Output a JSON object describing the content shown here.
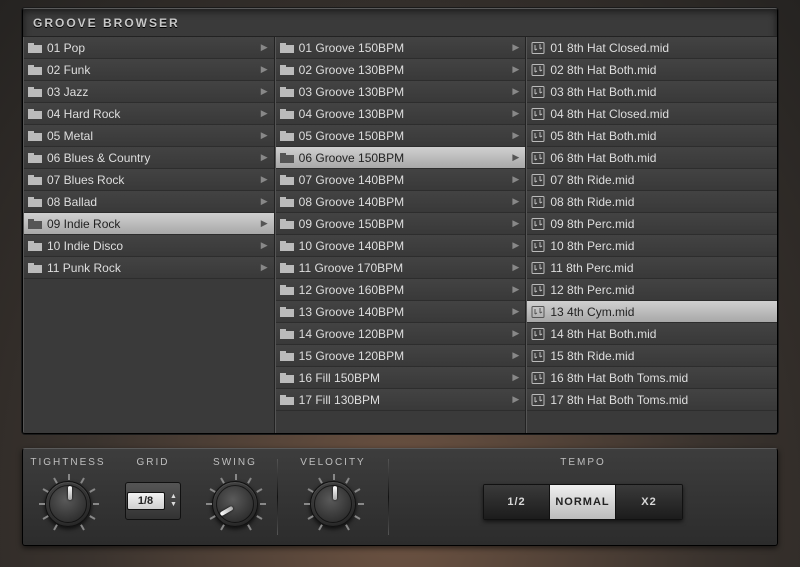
{
  "browser": {
    "title": "GROOVE BROWSER",
    "columns": [
      {
        "type": "folder",
        "selected_index": 8,
        "items": [
          {
            "label": "01 Pop",
            "expandable": true
          },
          {
            "label": "02 Funk",
            "expandable": true
          },
          {
            "label": "03 Jazz",
            "expandable": true
          },
          {
            "label": "04 Hard Rock",
            "expandable": true
          },
          {
            "label": "05 Metal",
            "expandable": true
          },
          {
            "label": "06 Blues & Country",
            "expandable": true
          },
          {
            "label": "07 Blues Rock",
            "expandable": true
          },
          {
            "label": "08 Ballad",
            "expandable": true
          },
          {
            "label": "09 Indie Rock",
            "expandable": true
          },
          {
            "label": "10 Indie Disco",
            "expandable": true
          },
          {
            "label": "11 Punk Rock",
            "expandable": true
          }
        ]
      },
      {
        "type": "folder",
        "selected_index": 5,
        "items": [
          {
            "label": "01 Groove 150BPM",
            "expandable": true
          },
          {
            "label": "02 Groove 130BPM",
            "expandable": true
          },
          {
            "label": "03 Groove 130BPM",
            "expandable": true
          },
          {
            "label": "04 Groove 130BPM",
            "expandable": true
          },
          {
            "label": "05 Groove 150BPM",
            "expandable": true
          },
          {
            "label": "06 Groove 150BPM",
            "expandable": true
          },
          {
            "label": "07 Groove 140BPM",
            "expandable": true
          },
          {
            "label": "08 Groove 140BPM",
            "expandable": true
          },
          {
            "label": "09 Groove 150BPM",
            "expandable": true
          },
          {
            "label": "10 Groove 140BPM",
            "expandable": true
          },
          {
            "label": "11 Groove 170BPM",
            "expandable": true
          },
          {
            "label": "12 Groove 160BPM",
            "expandable": true
          },
          {
            "label": "13 Groove 140BPM",
            "expandable": true
          },
          {
            "label": "14 Groove 120BPM",
            "expandable": true
          },
          {
            "label": "15 Groove 120BPM",
            "expandable": true
          },
          {
            "label": "16 Fill 150BPM",
            "expandable": true
          },
          {
            "label": "17 Fill 130BPM",
            "expandable": true
          }
        ]
      },
      {
        "type": "file",
        "selected_index": 12,
        "items": [
          {
            "label": "01 8th Hat Closed.mid"
          },
          {
            "label": "02 8th Hat Both.mid"
          },
          {
            "label": "03 8th Hat Both.mid"
          },
          {
            "label": "04 8th Hat Closed.mid"
          },
          {
            "label": "05 8th Hat Both.mid"
          },
          {
            "label": "06 8th Hat Both.mid"
          },
          {
            "label": "07 8th Ride.mid"
          },
          {
            "label": "08 8th Ride.mid"
          },
          {
            "label": "09 8th Perc.mid"
          },
          {
            "label": "10 8th Perc.mid"
          },
          {
            "label": "11 8th Perc.mid"
          },
          {
            "label": "12 8th Perc.mid"
          },
          {
            "label": "13 4th Cym.mid"
          },
          {
            "label": "14 8th Hat Both.mid"
          },
          {
            "label": "15 8th Ride.mid"
          },
          {
            "label": "16 8th Hat Both Toms.mid"
          },
          {
            "label": "17 8th Hat Both Toms.mid"
          }
        ]
      }
    ]
  },
  "controls": {
    "tightness": {
      "label": "TIGHTNESS",
      "angle": 0
    },
    "grid": {
      "label": "GRID",
      "value": "1/8"
    },
    "swing": {
      "label": "SWING",
      "angle": -120
    },
    "velocity": {
      "label": "VELOCITY",
      "angle": 0
    },
    "tempo": {
      "label": "TEMPO",
      "options": [
        "1/2",
        "NORMAL",
        "X2"
      ],
      "selected": 1
    }
  }
}
